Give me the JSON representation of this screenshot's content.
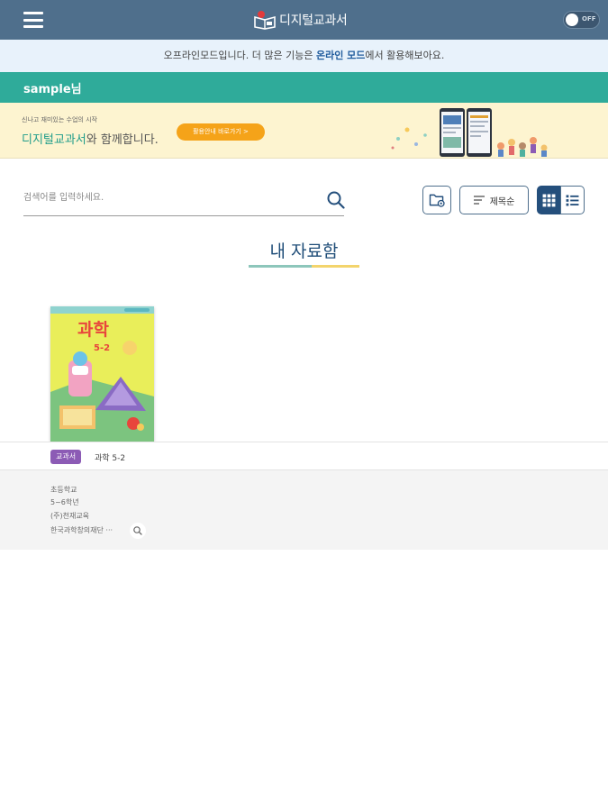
{
  "header": {
    "app_title": "디지털교과서",
    "toggle_label": "OFF"
  },
  "offline_notice": {
    "before": "오프라인모드입니다. 더 많은 기능은 ",
    "link": "온라인 모드",
    "after": "에서 활용해보아요."
  },
  "user": {
    "name": "sample님"
  },
  "banner": {
    "subtitle": "신나고 재미있는 수업의 시작",
    "title_highlight": "디지털교과서",
    "title_rest": "와 함께합니다.",
    "cta_label": "활용안내 바로가기 >"
  },
  "search": {
    "placeholder": "검색어를 입력하세요."
  },
  "toolbar": {
    "sort_label": "제목순"
  },
  "section": {
    "title": "내 자료함"
  },
  "book": {
    "cover_title": "과학",
    "cover_grade": "5-2",
    "badge": "교과서",
    "title": "과학 5-2",
    "school": "초등학교",
    "grade": "5~6학년",
    "publisher": "(주)천재교육",
    "author": "한국과학창의재단 ···"
  },
  "colors": {
    "header_bg": "#4f6f8c",
    "user_bar": "#2fab9a",
    "notice_bg": "#e8f2fb",
    "banner_bg": "#fdf4d0",
    "cta": "#f5a319",
    "badge": "#8c5bb5",
    "title": "#1f4d78",
    "view_active": "#244f7c"
  }
}
